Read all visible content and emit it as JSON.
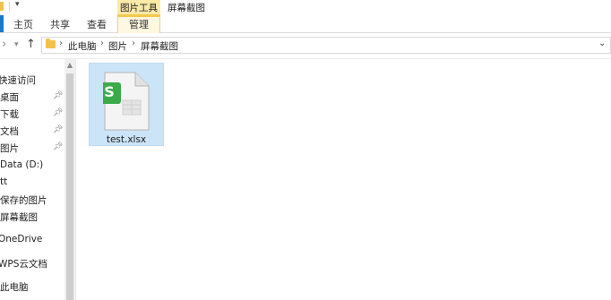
{
  "quick_access_toolbar": {
    "dropdown_glyph": "▾"
  },
  "contextual_tab_group": "图片工具",
  "window_title": "屏幕截图",
  "ribbon_tabs": [
    {
      "label": "主页"
    },
    {
      "label": "共享"
    },
    {
      "label": "查看"
    },
    {
      "label": "管理"
    }
  ],
  "address_bar": {
    "breadcrumbs": [
      "此电脑",
      "图片",
      "屏幕截图"
    ],
    "separator": "›"
  },
  "navigation_pane": {
    "items": [
      {
        "label": "快速访问",
        "pinned": false
      },
      {
        "label": "桌面",
        "pinned": true
      },
      {
        "label": "下载",
        "pinned": true
      },
      {
        "label": "文档",
        "pinned": true
      },
      {
        "label": "图片",
        "pinned": true
      },
      {
        "label": "Data (D:)",
        "pinned": false
      },
      {
        "label": "tt",
        "pinned": false
      },
      {
        "label": "保存的图片",
        "pinned": false
      },
      {
        "label": "屏幕截图",
        "pinned": false
      },
      {
        "label": "OneDrive",
        "pinned": false
      },
      {
        "label": "WPS云文档",
        "pinned": false
      },
      {
        "label": "此电脑",
        "pinned": false
      }
    ]
  },
  "files": [
    {
      "name": "test.xlsx",
      "icon": "wps-spreadsheet-icon",
      "badge": "S",
      "selected": true
    }
  ],
  "colors": {
    "selection": "#cce4f7",
    "wps_green": "#3bab4a",
    "contextual_yellow": "#fbe9a8"
  }
}
